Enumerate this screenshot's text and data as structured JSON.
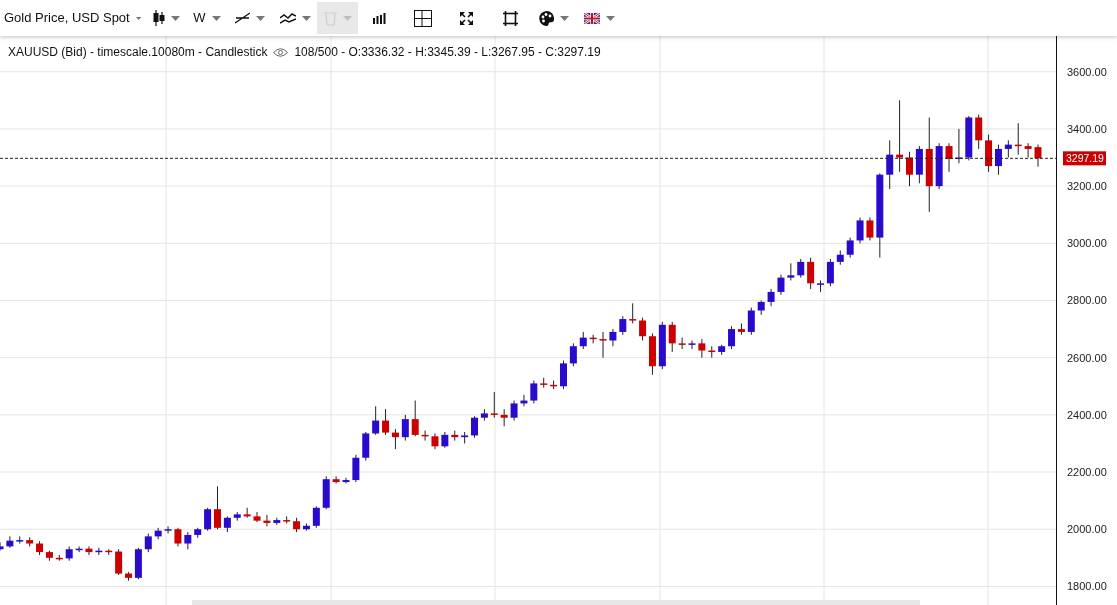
{
  "toolbar": [
    {
      "kind": "text",
      "label": "Gold Price, USD Spot",
      "caret": true,
      "disabled": false
    },
    {
      "kind": "icon",
      "caret": true,
      "disabled": false
    },
    {
      "kind": "text",
      "label": "W",
      "caret": true,
      "disabled": false
    },
    {
      "kind": "icon",
      "caret": true,
      "disabled": false
    },
    {
      "kind": "icon",
      "caret": true,
      "disabled": false
    },
    {
      "kind": "icon",
      "caret": true,
      "disabled": true
    },
    {
      "kind": "icon",
      "caret": false,
      "disabled": false
    },
    {
      "kind": "icon",
      "caret": false,
      "disabled": false
    },
    {
      "kind": "icon",
      "caret": false,
      "disabled": false
    },
    {
      "kind": "icon",
      "caret": false,
      "disabled": false
    },
    {
      "kind": "icon",
      "caret": true,
      "disabled": false
    },
    {
      "kind": "icon",
      "caret": true,
      "disabled": false
    }
  ],
  "legend": {
    "title": "XAUUSD (Bid) - timescale.10080m - Candlestick",
    "ohlc": "108/500 - O:3336.32 - H:3345.39 - L:3267.95 - C:3297.19"
  },
  "chart_data": {
    "type": "candlestick",
    "yticks": [
      {
        "value": 3600,
        "label": "3600.00"
      },
      {
        "value": 3400,
        "label": "3400.00"
      },
      {
        "value": 3200,
        "label": "3200.00"
      },
      {
        "value": 3000,
        "label": "3000.00"
      },
      {
        "value": 2800,
        "label": "2800.00"
      },
      {
        "value": 2600,
        "label": "2600.00"
      },
      {
        "value": 2400,
        "label": "2400.00"
      },
      {
        "value": 2200,
        "label": "2200.00"
      },
      {
        "value": 2000,
        "label": "2000.00"
      },
      {
        "value": 1800,
        "label": "1800.00"
      }
    ],
    "ylim": [
      1735,
      3725
    ],
    "grid": true,
    "ref_lines": [
      {
        "axis": "y",
        "value": 3297.19,
        "label": "3297.19"
      }
    ],
    "ohlc": [
      [
        1930,
        1955,
        1925,
        1940
      ],
      [
        1940,
        1975,
        1935,
        1960
      ],
      [
        1960,
        1975,
        1950,
        1962
      ],
      [
        1962,
        1972,
        1940,
        1950
      ],
      [
        1950,
        1958,
        1910,
        1920
      ],
      [
        1920,
        1925,
        1890,
        1900
      ],
      [
        1900,
        1910,
        1890,
        1898
      ],
      [
        1898,
        1940,
        1890,
        1930
      ],
      [
        1930,
        1940,
        1920,
        1932
      ],
      [
        1932,
        1940,
        1910,
        1920
      ],
      [
        1920,
        1935,
        1910,
        1925
      ],
      [
        1925,
        1930,
        1910,
        1922
      ],
      [
        1922,
        1930,
        1840,
        1845
      ],
      [
        1845,
        1850,
        1820,
        1830
      ],
      [
        1830,
        1935,
        1825,
        1930
      ],
      [
        1930,
        1985,
        1920,
        1975
      ],
      [
        1975,
        2005,
        1965,
        1995
      ],
      [
        1995,
        2010,
        1985,
        2000
      ],
      [
        2000,
        2005,
        1940,
        1950
      ],
      [
        1950,
        1990,
        1930,
        1980
      ],
      [
        1980,
        2005,
        1970,
        2000
      ],
      [
        2000,
        2075,
        1995,
        2070
      ],
      [
        2070,
        2150,
        2000,
        2005
      ],
      [
        2005,
        2045,
        1990,
        2040
      ],
      [
        2040,
        2060,
        2030,
        2052
      ],
      [
        2052,
        2075,
        2040,
        2045
      ],
      [
        2045,
        2060,
        2025,
        2030
      ],
      [
        2030,
        2050,
        2010,
        2022
      ],
      [
        2022,
        2040,
        2015,
        2032
      ],
      [
        2032,
        2045,
        2020,
        2028
      ],
      [
        2028,
        2040,
        1990,
        2000
      ],
      [
        2000,
        2020,
        1995,
        2012
      ],
      [
        2012,
        2080,
        2005,
        2075
      ],
      [
        2075,
        2185,
        2070,
        2175
      ],
      [
        2175,
        2185,
        2160,
        2165
      ],
      [
        2165,
        2180,
        2160,
        2172
      ],
      [
        2172,
        2260,
        2165,
        2250
      ],
      [
        2250,
        2340,
        2240,
        2335
      ],
      [
        2335,
        2430,
        2330,
        2380
      ],
      [
        2380,
        2420,
        2330,
        2338
      ],
      [
        2338,
        2350,
        2280,
        2322
      ],
      [
        2322,
        2400,
        2310,
        2385
      ],
      [
        2385,
        2450,
        2325,
        2330
      ],
      [
        2330,
        2345,
        2310,
        2325
      ],
      [
        2325,
        2335,
        2280,
        2290
      ],
      [
        2290,
        2340,
        2285,
        2330
      ],
      [
        2330,
        2345,
        2310,
        2322
      ],
      [
        2322,
        2340,
        2300,
        2328
      ],
      [
        2328,
        2395,
        2320,
        2390
      ],
      [
        2390,
        2420,
        2380,
        2405
      ],
      [
        2405,
        2480,
        2390,
        2400
      ],
      [
        2400,
        2420,
        2360,
        2390
      ],
      [
        2390,
        2450,
        2380,
        2440
      ],
      [
        2440,
        2470,
        2430,
        2450
      ],
      [
        2450,
        2520,
        2440,
        2510
      ],
      [
        2510,
        2530,
        2495,
        2505
      ],
      [
        2505,
        2520,
        2490,
        2500
      ],
      [
        2500,
        2590,
        2490,
        2580
      ],
      [
        2580,
        2650,
        2570,
        2640
      ],
      [
        2640,
        2690,
        2630,
        2670
      ],
      [
        2670,
        2680,
        2650,
        2665
      ],
      [
        2665,
        2690,
        2600,
        2660
      ],
      [
        2660,
        2700,
        2640,
        2690
      ],
      [
        2690,
        2745,
        2680,
        2735
      ],
      [
        2735,
        2790,
        2720,
        2730
      ],
      [
        2730,
        2740,
        2660,
        2675
      ],
      [
        2675,
        2685,
        2540,
        2570
      ],
      [
        2570,
        2725,
        2560,
        2715
      ],
      [
        2715,
        2725,
        2620,
        2650
      ],
      [
        2650,
        2670,
        2630,
        2645
      ],
      [
        2645,
        2660,
        2630,
        2650
      ],
      [
        2650,
        2665,
        2600,
        2625
      ],
      [
        2625,
        2640,
        2600,
        2620
      ],
      [
        2620,
        2645,
        2610,
        2640
      ],
      [
        2640,
        2710,
        2630,
        2700
      ],
      [
        2700,
        2720,
        2680,
        2690
      ],
      [
        2690,
        2775,
        2680,
        2765
      ],
      [
        2765,
        2800,
        2750,
        2795
      ],
      [
        2795,
        2840,
        2780,
        2830
      ],
      [
        2830,
        2890,
        2820,
        2880
      ],
      [
        2880,
        2930,
        2870,
        2888
      ],
      [
        2888,
        2945,
        2880,
        2935
      ],
      [
        2935,
        2950,
        2840,
        2860
      ],
      [
        2860,
        2870,
        2830,
        2860
      ],
      [
        2860,
        2945,
        2850,
        2935
      ],
      [
        2935,
        2975,
        2925,
        2960
      ],
      [
        2960,
        3020,
        2950,
        3010
      ],
      [
        3010,
        3090,
        3000,
        3080
      ],
      [
        3080,
        3090,
        3010,
        3020
      ],
      [
        3020,
        3245,
        2950,
        3240
      ],
      [
        3240,
        3360,
        3190,
        3310
      ],
      [
        3310,
        3500,
        3250,
        3300
      ],
      [
        3300,
        3320,
        3200,
        3240
      ],
      [
        3240,
        3340,
        3210,
        3330
      ],
      [
        3330,
        3440,
        3110,
        3200
      ],
      [
        3200,
        3350,
        3190,
        3340
      ],
      [
        3340,
        3350,
        3250,
        3295
      ],
      [
        3295,
        3400,
        3280,
        3300
      ],
      [
        3300,
        3445,
        3290,
        3440
      ],
      [
        3440,
        3450,
        3330,
        3360
      ],
      [
        3360,
        3380,
        3250,
        3270
      ],
      [
        3270,
        3345,
        3240,
        3330
      ],
      [
        3330,
        3360,
        3300,
        3345
      ],
      [
        3345,
        3420,
        3310,
        3340
      ],
      [
        3340,
        3350,
        3300,
        3330
      ],
      [
        3336.32,
        3345.39,
        3267.95,
        3297.19
      ]
    ]
  }
}
